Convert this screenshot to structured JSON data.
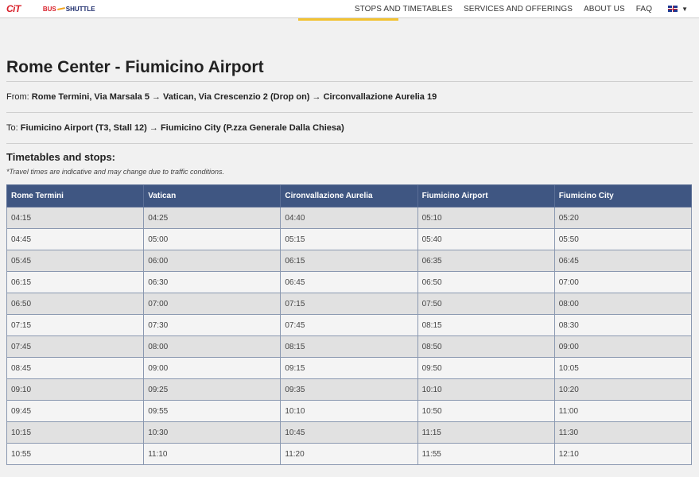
{
  "brand": {
    "cit": "CiT",
    "bus": "BUS",
    "shuttle": "SHUTTLE"
  },
  "nav": {
    "items": [
      "STOPS AND TIMETABLES",
      "SERVICES AND OFFERINGS",
      "ABOUT US",
      "FAQ"
    ],
    "lang_caret": "▼"
  },
  "page": {
    "title": "Rome Center - Fiumicino Airport",
    "from_label": "From: ",
    "from_value": "Rome Termini, Via Marsala 5 → Vatican, Via Crescenzio 2 (Drop on) → Circonvallazione Aurelia 19",
    "to_label": "To: ",
    "to_value": "Fiumicino Airport (T3, Stall 12) → Fiumicino City (P.zza Generale Dalla Chiesa)",
    "timetables_heading": "Timetables and stops:",
    "note": "*Travel times are indicative and may change due to traffic conditions."
  },
  "table": {
    "headers": [
      "Rome Termini",
      "Vatican",
      "Cironvallazione Aurelia",
      "Fiumicino Airport",
      "Fiumicino City"
    ],
    "rows": [
      [
        "04:15",
        "04:25",
        "04:40",
        "05:10",
        "05:20"
      ],
      [
        "04:45",
        "05:00",
        "05:15",
        "05:40",
        "05:50"
      ],
      [
        "05:45",
        "06:00",
        "06:15",
        "06:35",
        "06:45"
      ],
      [
        "06:15",
        "06:30",
        "06:45",
        "06:50",
        "07:00"
      ],
      [
        "06:50",
        "07:00",
        "07:15",
        "07:50",
        "08:00"
      ],
      [
        "07:15",
        "07:30",
        "07:45",
        "08:15",
        "08:30"
      ],
      [
        "07:45",
        "08:00",
        "08:15",
        "08:50",
        "09:00"
      ],
      [
        "08:45",
        "09:00",
        "09:15",
        "09:50",
        "10:05"
      ],
      [
        "09:10",
        "09:25",
        "09:35",
        "10:10",
        "10:20"
      ],
      [
        "09:45",
        "09:55",
        "10:10",
        "10:50",
        "11:00"
      ],
      [
        "10:15",
        "10:30",
        "10:45",
        "11:15",
        "11:30"
      ],
      [
        "10:55",
        "11:10",
        "11:20",
        "11:55",
        "12:10"
      ]
    ]
  }
}
